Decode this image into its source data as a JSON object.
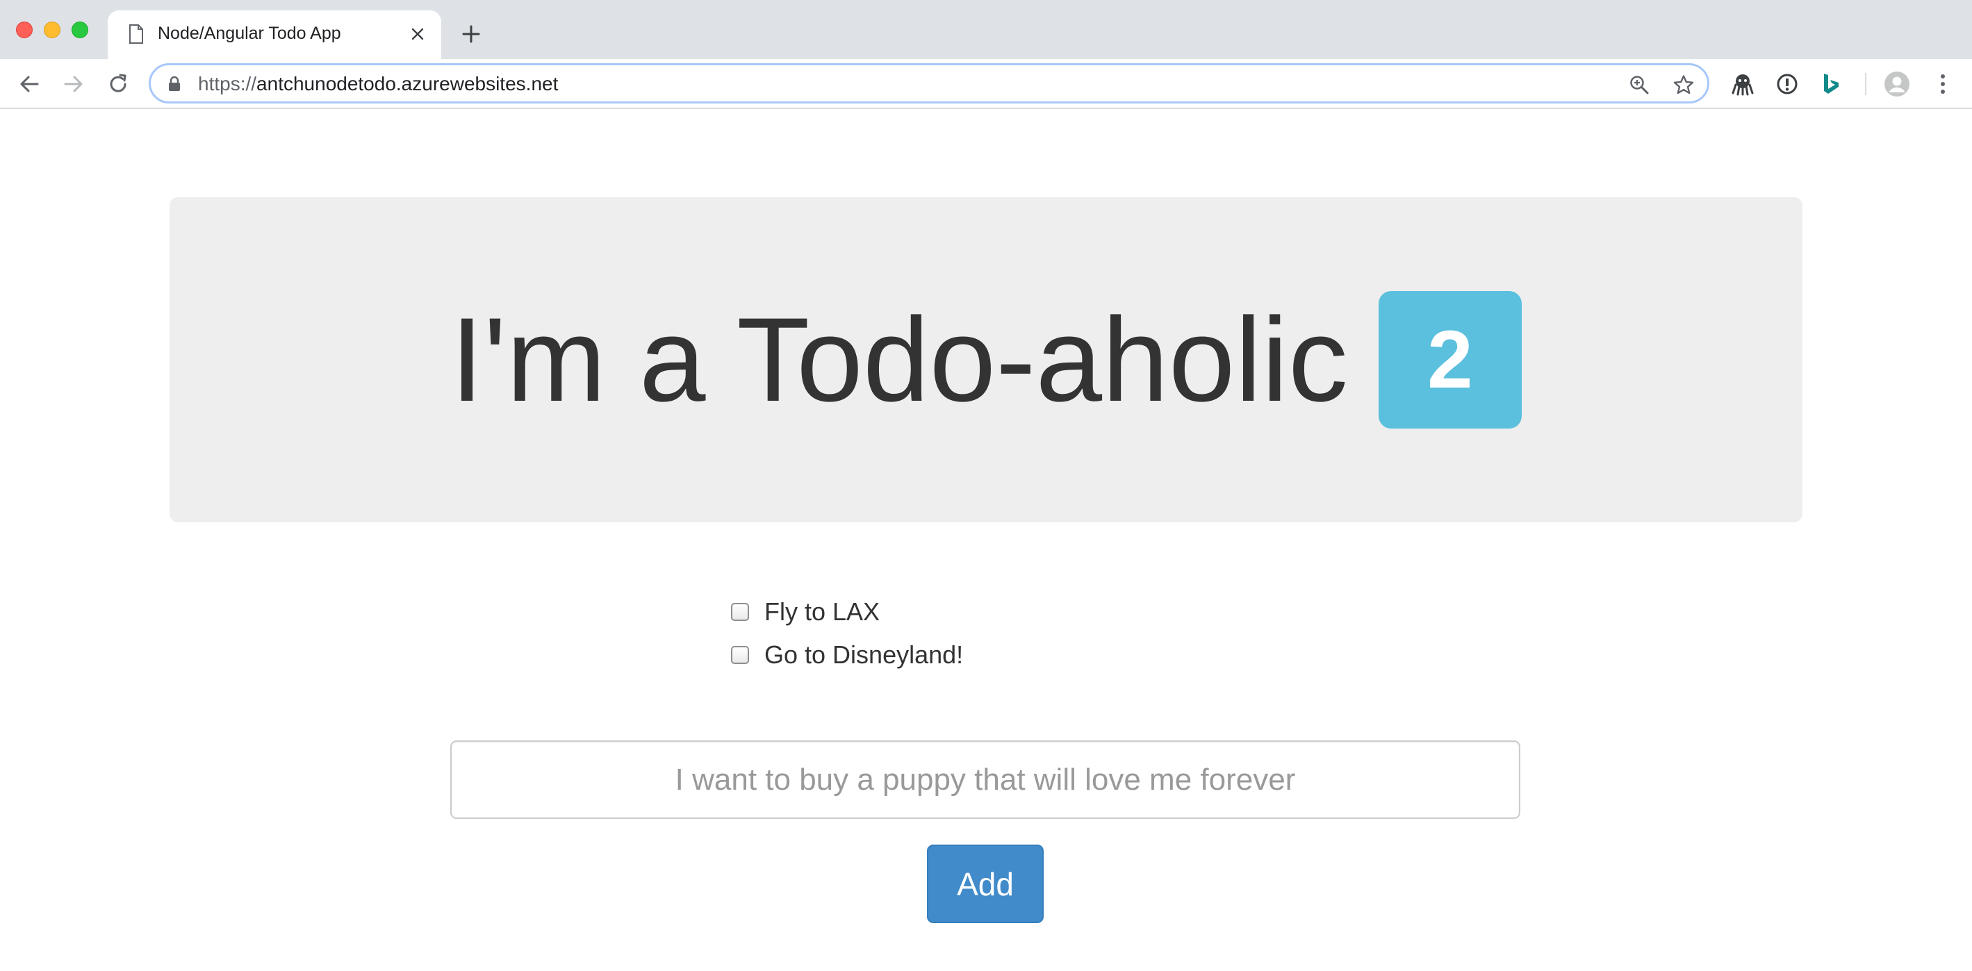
{
  "browser": {
    "tab_title": "Node/Angular Todo App",
    "url_scheme": "https://",
    "url_host": "antchunodetodo.azurewebsites.net"
  },
  "header": {
    "title": "I'm a Todo-aholic",
    "todo_count": "2",
    "badge_color": "#5bc0de"
  },
  "todos": [
    {
      "text": "Fly to LAX",
      "done": false
    },
    {
      "text": "Go to Disneyland!",
      "done": false
    }
  ],
  "form": {
    "input_placeholder": "I want to buy a puppy that will love me forever",
    "input_value": "",
    "add_label": "Add",
    "button_color": "#428bca"
  }
}
